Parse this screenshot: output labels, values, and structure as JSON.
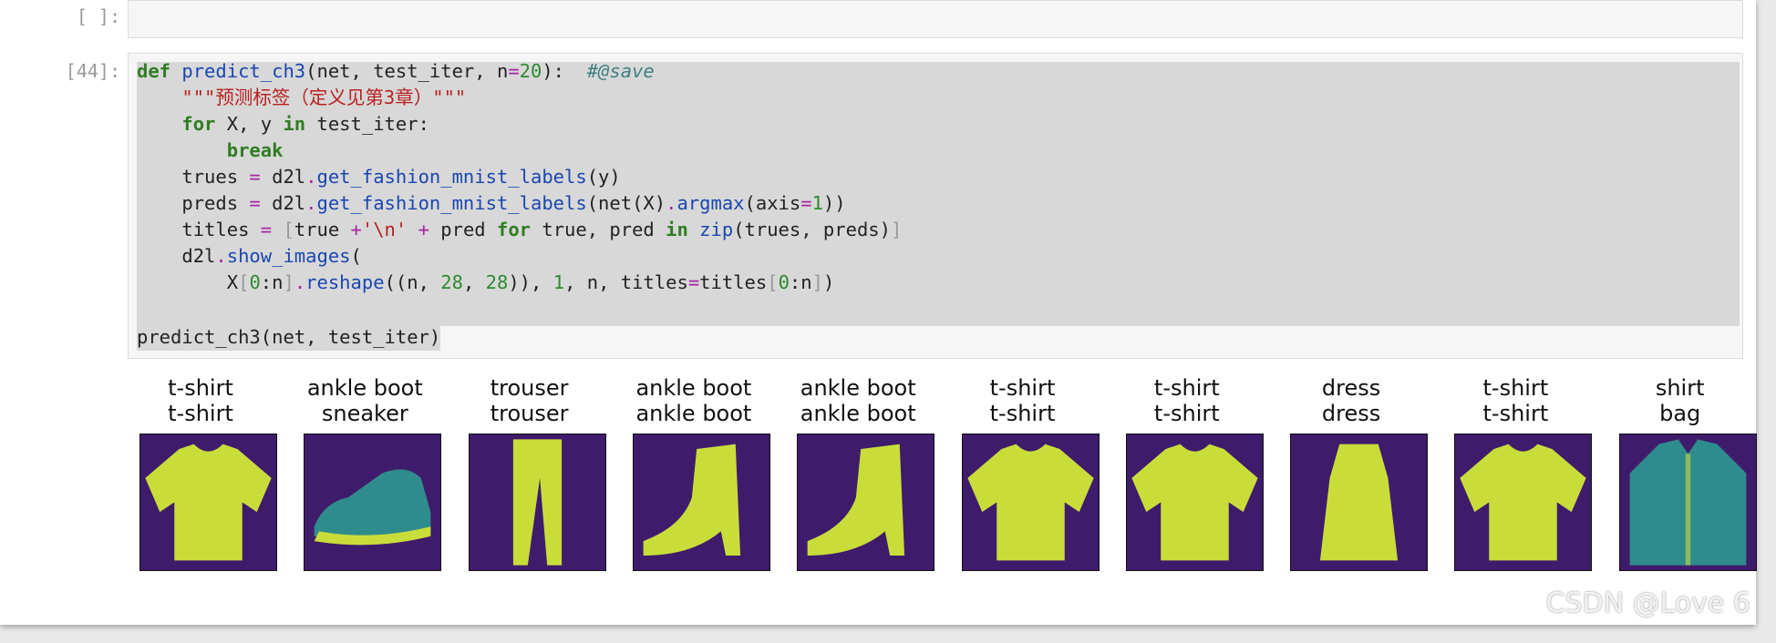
{
  "cells": [
    {
      "prompt": "[ ]:"
    },
    {
      "prompt": "[44]:",
      "code_call": "predict_ch3(net, test_iter)"
    }
  ],
  "outputs": [
    {
      "true_label": "t-shirt",
      "pred_label": "t-shirt",
      "icon": "tshirt-icon"
    },
    {
      "true_label": "ankle boot",
      "pred_label": "sneaker",
      "icon": "sneaker-icon"
    },
    {
      "true_label": "trouser",
      "pred_label": "trouser",
      "icon": "trouser-icon"
    },
    {
      "true_label": "ankle boot",
      "pred_label": "ankle boot",
      "icon": "ankle-boot-icon"
    },
    {
      "true_label": "ankle boot",
      "pred_label": "ankle boot",
      "icon": "ankle-boot-icon"
    },
    {
      "true_label": "t-shirt",
      "pred_label": "t-shirt",
      "icon": "tshirt-icon"
    },
    {
      "true_label": "t-shirt",
      "pred_label": "t-shirt",
      "icon": "tshirt-icon"
    },
    {
      "true_label": "dress",
      "pred_label": "dress",
      "icon": "dress-icon"
    },
    {
      "true_label": "t-shirt",
      "pred_label": "t-shirt",
      "icon": "tshirt-icon"
    },
    {
      "true_label": "shirt",
      "pred_label": "bag",
      "icon": "shirt-icon"
    }
  ],
  "colors": {
    "fg_yellow": "#c9dd3a",
    "fg_teal": "#2f8c8c",
    "bg_purple": "#3f1b6b"
  },
  "watermark": "CSDN @Love 6"
}
